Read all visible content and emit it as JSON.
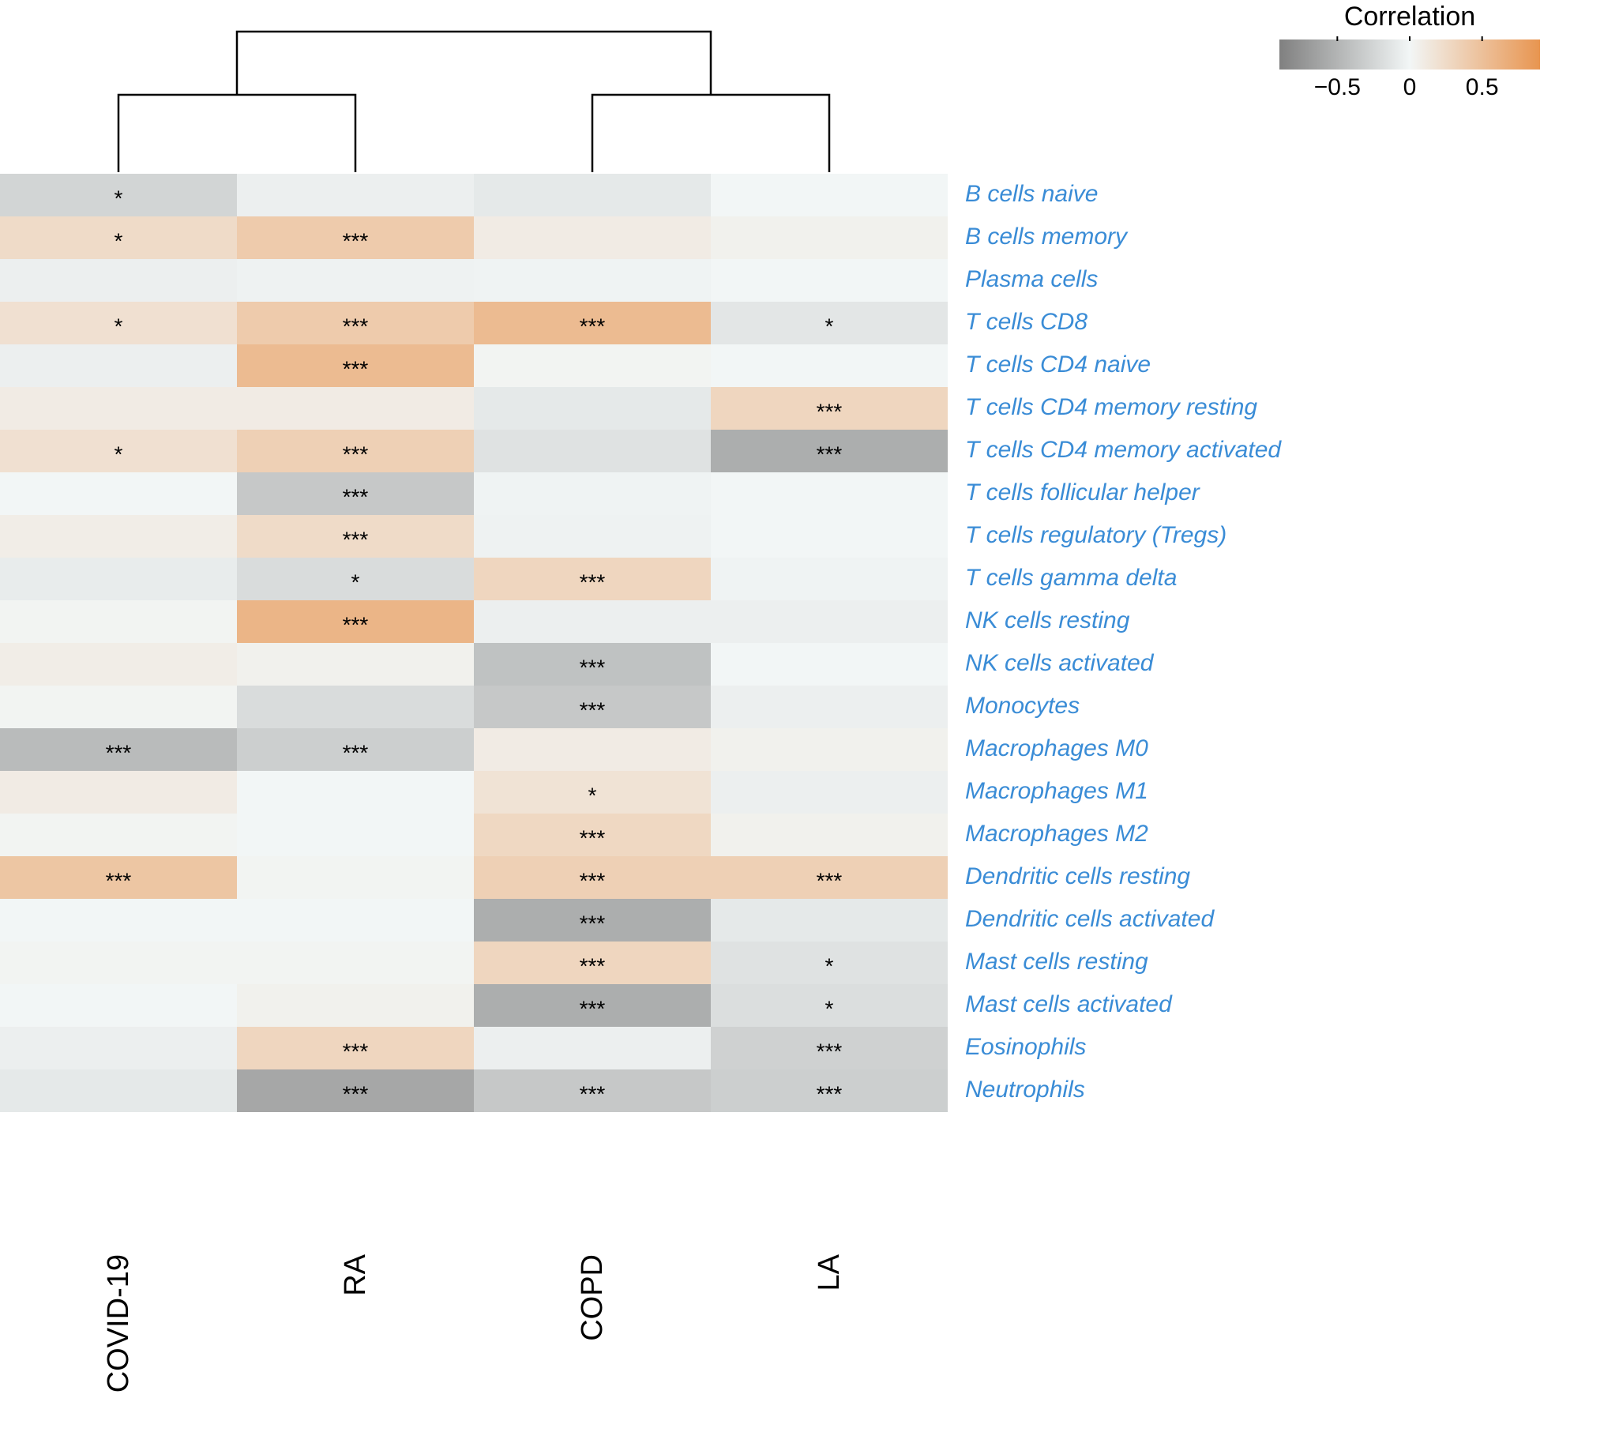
{
  "chart_data": {
    "type": "heatmap",
    "legend": {
      "title": "Correlation",
      "min": -0.9,
      "max": 0.9,
      "ticks": [
        -0.5,
        0,
        0.5
      ],
      "colors": {
        "neg": "#808080",
        "zero": "#f2f6f6",
        "pos": "#e89550"
      }
    },
    "columns": [
      "COVID-19",
      "RA",
      "COPD",
      "LA"
    ],
    "rows": [
      "B cells naive",
      "B cells memory",
      "Plasma cells",
      "T cells CD8",
      "T cells CD4 naive",
      "T cells CD4 memory resting",
      "T cells CD4 memory activated",
      "T cells follicular helper",
      "T cells regulatory (Tregs)",
      "T cells gamma delta",
      "NK cells resting",
      "NK cells activated",
      "Monocytes",
      "Macrophages M0",
      "Macrophages M1",
      "Macrophages M2",
      "Dendritic cells resting",
      "Dendritic cells activated",
      "Mast cells resting",
      "Mast cells activated",
      "Eosinophils",
      "Neutrophils"
    ],
    "values": [
      [
        -0.25,
        -0.05,
        -0.1,
        0.0
      ],
      [
        0.25,
        0.4,
        0.1,
        0.05
      ],
      [
        -0.05,
        -0.03,
        -0.02,
        0.0
      ],
      [
        0.2,
        0.4,
        0.55,
        -0.12
      ],
      [
        -0.05,
        0.55,
        0.02,
        0.0
      ],
      [
        0.1,
        0.1,
        -0.1,
        0.3
      ],
      [
        0.2,
        0.35,
        -0.15,
        -0.55
      ],
      [
        0.0,
        -0.35,
        -0.02,
        0.0
      ],
      [
        0.08,
        0.25,
        -0.03,
        0.0
      ],
      [
        -0.08,
        -0.2,
        0.3,
        -0.02
      ],
      [
        0.02,
        0.6,
        -0.05,
        -0.05
      ],
      [
        0.08,
        0.05,
        -0.4,
        0.0
      ],
      [
        0.02,
        -0.2,
        -0.35,
        -0.05
      ],
      [
        -0.45,
        -0.3,
        0.1,
        0.05
      ],
      [
        0.1,
        0.0,
        0.18,
        -0.05
      ],
      [
        0.02,
        0.0,
        0.28,
        0.05
      ],
      [
        0.45,
        0.02,
        0.35,
        0.35
      ],
      [
        0.0,
        0.0,
        -0.55,
        -0.1
      ],
      [
        0.02,
        0.02,
        0.3,
        -0.15
      ],
      [
        0.0,
        0.05,
        -0.55,
        -0.18
      ],
      [
        -0.05,
        0.3,
        -0.05,
        -0.28
      ],
      [
        -0.1,
        -0.6,
        -0.35,
        -0.3
      ]
    ],
    "significance": [
      [
        "*",
        "",
        "",
        ""
      ],
      [
        "*",
        "***",
        "",
        ""
      ],
      [
        "",
        "",
        "",
        ""
      ],
      [
        "*",
        "***",
        "***",
        "*"
      ],
      [
        "",
        "***",
        "",
        ""
      ],
      [
        "",
        "",
        "",
        "***"
      ],
      [
        "*",
        "***",
        "",
        "***"
      ],
      [
        "",
        "***",
        "",
        ""
      ],
      [
        "",
        "***",
        "",
        ""
      ],
      [
        "",
        "*",
        "***",
        ""
      ],
      [
        "",
        "***",
        "",
        ""
      ],
      [
        "",
        "",
        "***",
        ""
      ],
      [
        "",
        "",
        "***",
        ""
      ],
      [
        "***",
        "***",
        "",
        ""
      ],
      [
        "",
        "",
        "*",
        ""
      ],
      [
        "",
        "",
        "***",
        ""
      ],
      [
        "***",
        "",
        "***",
        "***"
      ],
      [
        "",
        "",
        "***",
        ""
      ],
      [
        "",
        "",
        "***",
        "*"
      ],
      [
        "",
        "",
        "***",
        "*"
      ],
      [
        "",
        "***",
        "",
        "***"
      ],
      [
        "",
        "***",
        "***",
        "***"
      ]
    ],
    "dendrogram": {
      "leaves_order": [
        0,
        1,
        2,
        3
      ],
      "structure": "( (COVID-19, RA), (COPD, LA) )"
    }
  }
}
